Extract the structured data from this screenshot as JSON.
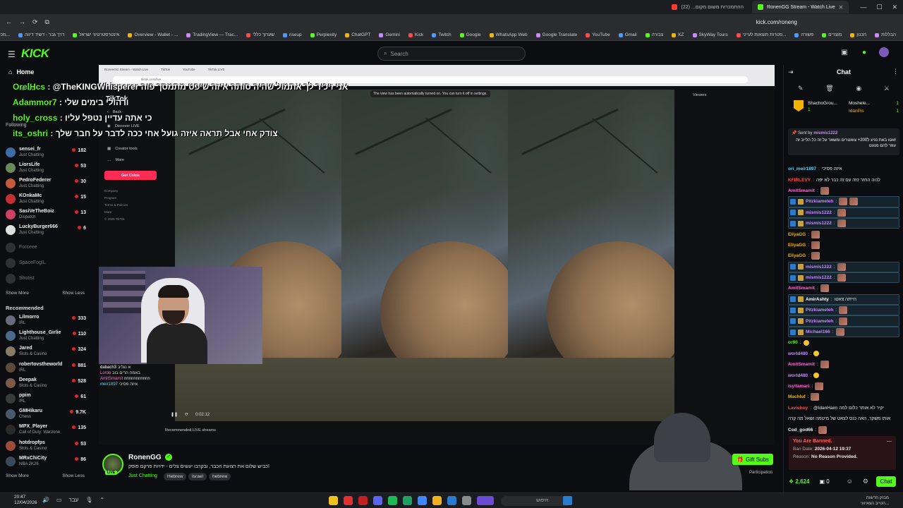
{
  "browser": {
    "tabs": [
      {
        "label": "RonenGG Stream - Watch Live",
        "active": true
      },
      {
        "label": "ההתמכרות משום מקום... (22)",
        "active": false
      }
    ],
    "url": "kick.com/roneng",
    "bookmarks": [
      "מכללת כלל הבינה הת...",
      "דרך גבר - דשיד דיווה",
      "אינטרסטרטיגי ישראל",
      "Overview - Wallet - ...",
      "TradingView — Trac...",
      "שערוך כללי",
      "riseup",
      "Perplexity",
      "ChatGPT",
      "Gemini",
      "Kick",
      "Twitch",
      "Google",
      "WhatsApp Web",
      "Google Translate",
      "YouTube",
      "Gmail",
      "צבורה",
      "KZ",
      "SkyWay Tours",
      "פטרות תוצאות לעייני...",
      "פשורה",
      "מוצרים",
      "תכנון",
      "הבללות"
    ]
  },
  "header": {
    "logo": "KICK",
    "search_placeholder": "Search"
  },
  "sidebar": {
    "home_label": "Home",
    "browse_label": "Browse",
    "following_label": "Following",
    "following": [
      {
        "name": "sensei_fr",
        "category": "Just Chatting",
        "viewers": "182",
        "color": "#3b6ea5"
      },
      {
        "name": "LiorsLife",
        "category": "Just Chatting",
        "viewers": "53",
        "color": "#6a8a5a"
      },
      {
        "name": "PedroFederer",
        "category": "Just Chatting",
        "viewers": "30",
        "color": "#c45a3a"
      },
      {
        "name": "KOnkaMc",
        "category": "Just Chatting",
        "viewers": "15",
        "color": "#c43030"
      },
      {
        "name": "SasiVeTheBoiz",
        "category": "Dispatch",
        "viewers": "13",
        "color": "#d04060"
      },
      {
        "name": "LuckyBurger666",
        "category": "Just Chatting",
        "viewers": "6",
        "color": "#e0e0e0"
      }
    ],
    "offline": [
      "Forceee",
      "SpaceFogIL",
      "Shotist"
    ],
    "show_more": "Show More",
    "show_less": "Show Less",
    "recommended_label": "Recommended",
    "recommended": [
      {
        "name": "Lilmorro",
        "category": "IRL",
        "viewers": "333",
        "color": "#6a6a7a"
      },
      {
        "name": "Lighthouse_Girlie",
        "category": "Just Chatting",
        "viewers": "110",
        "color": "#4a6a8a"
      },
      {
        "name": "Jared",
        "category": "Slots & Casino",
        "viewers": "324",
        "color": "#8a7a6a"
      },
      {
        "name": "robertovstheworld",
        "category": "IRL",
        "viewers": "881",
        "color": "#5a4a3a"
      },
      {
        "name": "Deepak",
        "category": "Slots & Casino",
        "viewers": "528",
        "color": "#7a5a4a"
      },
      {
        "name": "ppim",
        "category": "IRL",
        "viewers": "61",
        "color": "#3a3a3a"
      },
      {
        "name": "GMHikaru",
        "category": "Chess",
        "viewers": "9.7K",
        "color": "#4a5a6a"
      },
      {
        "name": "MPX_Player",
        "category": "Call of Duty: Warzone",
        "viewers": "135",
        "color": "#2a2a2a"
      },
      {
        "name": "hotdropfps",
        "category": "Slots & Casino",
        "viewers": "53",
        "color": "#a04a3a"
      },
      {
        "name": "MRxChiCity",
        "category": "NBA 2K26",
        "viewers": "86",
        "color": "#3a4a5a"
      }
    ]
  },
  "overlay_chat": [
    {
      "user": "OrelHcs",
      "text": "@TheKINGWhisperer אני זיכיר לך אתמול שהיה סותה איזה שיפט מתמסך פוה"
    },
    {
      "user": "Adammor7",
      "text": "ורהולי בימים שלי"
    },
    {
      "user": "holy_cross",
      "text": "כי אתה עדיין נטפל עליו"
    },
    {
      "user": "its_oshri",
      "text": "צודק אחי אבל תראה איזה גועל אחי ככה לדבר על חבר שלך"
    }
  ],
  "stream": {
    "tiktok_label": "TikTok",
    "tiktok_menu": [
      "Back",
      "Discover LIVE",
      "Creator tools",
      "More"
    ],
    "get_coins": "Get Coins",
    "tiktok_footer": [
      "Company",
      "Program",
      "Terms & Policies",
      "More",
      "© 2026 TikTok"
    ],
    "notice": "The view has been automatically turned on. You can turn it off in settings.",
    "viewers_label": "Viewers",
    "time": "0:02:12",
    "recommended_live": "Recommended LIVE streams",
    "webcam_chat": [
      {
        "user": "dabach3",
        "text": "א נגליב"
      },
      {
        "user": "Lordo",
        "text": "באמה הרים בוב"
      },
      {
        "user": "AmitSmamit",
        "text": "nnnnnnnnnnn"
      },
      {
        "user": "meir1897",
        "text": "איזה פסיכי"
      }
    ]
  },
  "streamer": {
    "name": "RonenGG",
    "title": "כביש שלום את רצועת הכבר, ובקרבו יעשים צלים - ידויות פרקם פוסק!",
    "category": "Just Chatting",
    "tags": [
      "Hebrew",
      "Israel",
      "hebrew"
    ],
    "live": "LIVE",
    "gift_subs": "Gift Subs",
    "participation": "Participation"
  },
  "chat": {
    "title": "Chat",
    "leaderboard": [
      {
        "name": "ShachoGrou...",
        "value": "1"
      },
      {
        "name": "Moshele...",
        "value": "1"
      },
      {
        "name": "IdanPis",
        "value": "1"
      }
    ],
    "pinned": {
      "sent_by_label": "Sent by",
      "sender": "mismis1222",
      "text": "זאטו באת נגיע ל200+ צואטרים ומשאר על זה כל הלייב זה עוזר להם מנעט"
    },
    "messages": [
      {
        "user": "ori_meir1897",
        "color": "#53d6ff",
        "text": "איזה פסיכי",
        "hl": false,
        "emote": ""
      },
      {
        "user": "KFIRLEVY",
        "color": "#ff4a4a",
        "text": "לכוה החזר כזה עם זה כבר לא יפה",
        "hl": false,
        "emote": ""
      },
      {
        "user": "AmitSmamit",
        "color": "#ff6ad5",
        "text": "",
        "hl": false,
        "emote": "img"
      },
      {
        "user": "Pitzkiameleh",
        "color": "#c888ff",
        "text": "",
        "hl": true,
        "emote": "img2"
      },
      {
        "user": "mismis1222",
        "color": "#c888ff",
        "text": "",
        "hl": true,
        "emote": "img"
      },
      {
        "user": "mismis1222",
        "color": "#c888ff",
        "text": "",
        "hl": true,
        "emote": "img"
      },
      {
        "user": "EliyaGG",
        "color": "#f2b400",
        "text": "",
        "hl": false,
        "emote": "img"
      },
      {
        "user": "EliyaGG",
        "color": "#f2b400",
        "text": "",
        "hl": false,
        "emote": "img"
      },
      {
        "user": "EliyaGG",
        "color": "#f2b400",
        "text": "",
        "hl": false,
        "emote": "img"
      },
      {
        "user": "mismis1222",
        "color": "#c888ff",
        "text": "",
        "hl": true,
        "emote": "img"
      },
      {
        "user": "mismis1222",
        "color": "#c888ff",
        "text": "",
        "hl": true,
        "emote": "img"
      },
      {
        "user": "AmitSmamit",
        "color": "#ff6ad5",
        "text": "",
        "hl": false,
        "emote": "img"
      },
      {
        "user": "AmirAshty",
        "color": "#ffffff",
        "text": "הייתה צאטו",
        "hl": true,
        "emote": ""
      },
      {
        "user": "Pitzkiameleh",
        "color": "#c888ff",
        "text": "",
        "hl": true,
        "emote": "img"
      },
      {
        "user": "Pitzkiameleh",
        "color": "#c888ff",
        "text": "",
        "hl": true,
        "emote": "img"
      },
      {
        "user": "Michael166",
        "color": "#c888ff",
        "text": "",
        "hl": true,
        "emote": "img"
      },
      {
        "user": "or90",
        "color": "#53fc18",
        "text": "",
        "hl": false,
        "emote": "yel"
      },
      {
        "user": "world480",
        "color": "#c888ff",
        "text": "",
        "hl": false,
        "emote": "yel"
      },
      {
        "user": "AmitSmamit",
        "color": "#ff6ad5",
        "text": "",
        "hl": false,
        "emote": "img"
      },
      {
        "user": "world480",
        "color": "#c888ff",
        "text": "",
        "hl": false,
        "emote": "yel"
      },
      {
        "user": "isyitamari",
        "color": "#ff6ad5",
        "text": "",
        "hl": false,
        "emote": "img"
      },
      {
        "user": "Machluf",
        "color": "#f2b400",
        "text": "",
        "hl": false,
        "emote": "img"
      },
      {
        "user": "Lavieboy",
        "color": "#ff4a4a",
        "text": "@IdanHaim יקיר לא אותר כלום למה",
        "hl": false,
        "emote": ""
      },
      {
        "user": "",
        "color": "#ccc",
        "text": "אותו משקר, האה כנס לצאט של מיטמה ושאל מה קרה",
        "hl": false,
        "emote": ""
      },
      {
        "user": "Cod_god66",
        "color": "#eee",
        "text": "",
        "hl": false,
        "emote": "img"
      }
    ],
    "banned": {
      "title": "You Are Banned.",
      "ban_date_label": "Ban Date:",
      "ban_date": "2026-04-12 19:37",
      "reason_label": "Reason:",
      "reason": "No Reason Provided."
    },
    "points": "2,624",
    "zero": "0",
    "send": "Chat"
  },
  "taskbar": {
    "time": "20:47",
    "date": "12/04/2026",
    "lang": "עבר",
    "search": "חיפוש",
    "news": "מבזק חדשות",
    "news_sub": "הטייב הצאיועי..."
  }
}
